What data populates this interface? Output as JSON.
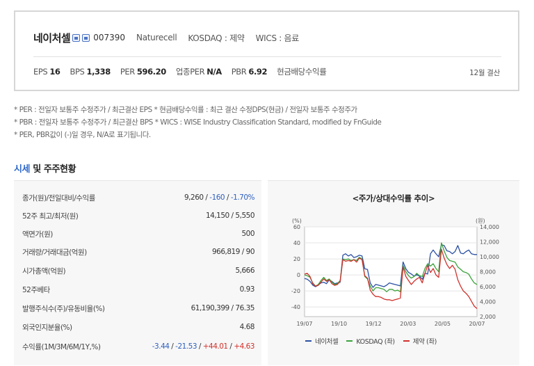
{
  "company": {
    "name": "네이처셀",
    "code": "007390",
    "english_name": "Naturecell",
    "market": "KOSDAQ : 제약",
    "wics": "WICS : 음료",
    "settlement": "12월 결산",
    "metrics": [
      {
        "label": "EPS",
        "value": "16"
      },
      {
        "label": "BPS",
        "value": "1,338"
      },
      {
        "label": "PER",
        "value": "596.20"
      },
      {
        "label": "업종PER",
        "value": "N/A"
      },
      {
        "label": "PBR",
        "value": "6.92"
      },
      {
        "label": "현금배당수익률",
        "value": ""
      }
    ]
  },
  "notes": [
    "* PER : 전일자 보통주 수정주가 / 최근결산 EPS * 현금배당수익률 : 최근 결산 수정DPS(현금) / 전일자 보통주 수정주가",
    "* PBR : 전일자 보통주 수정주가 / 최근결산 BPS * WICS : WISE Industry Classification Standard, modified by FnGuide",
    "* PER, PBR값이 (-)일 경우, N/A로 표기됩니다."
  ],
  "section": {
    "title_accent": "시세",
    "title_rest": " 및 주주현황"
  },
  "stats": {
    "price_label": "종가(원)/전일대비/수익률",
    "price": "9,260",
    "change": "-160",
    "change_rate": "-1.70%",
    "rows": [
      {
        "label": "52주 최고/최저(원)",
        "value": "14,150 / 5,550"
      },
      {
        "label": "액면가(원)",
        "value": "500"
      },
      {
        "label": "거래량/거래대금(억원)",
        "value": "966,819 / 90"
      },
      {
        "label": "시가총액(억원)",
        "value": "5,666"
      },
      {
        "label": "52주베타",
        "value": "0.93"
      },
      {
        "label": "발행주식수(주)/유동비율(%)",
        "value": "61,190,399 / 76.35"
      },
      {
        "label": "외국인지분율(%)",
        "value": "4.68"
      }
    ],
    "returns_label": "수익률(1M/3M/6M/1Y,%)",
    "returns": [
      "-3.44",
      "-21.53",
      "+44.01",
      "+4.63"
    ]
  },
  "chart_data": {
    "type": "line",
    "title": "<주가/상대수익률 추이>",
    "x_ticks": [
      "19/07",
      "19/10",
      "19/12",
      "20/03",
      "20/05",
      "20/07"
    ],
    "left_axis": {
      "unit": "(%)",
      "ticks": [
        60,
        40,
        20,
        0,
        -20,
        -40
      ],
      "range": [
        -52,
        60
      ]
    },
    "right_axis": {
      "unit": "(원)",
      "ticks": [
        "14,000",
        "12,000",
        "10,000",
        "8,000",
        "6,000",
        "4,000",
        "2,000"
      ],
      "range": [
        2000,
        14000
      ]
    },
    "series": [
      {
        "name": "네이처셀",
        "axis": "right",
        "color": "#2b4fa3",
        "values": [
          7100,
          7000,
          6700,
          6200,
          6000,
          6200,
          6500,
          6600,
          6400,
          6900,
          6700,
          6400,
          6500,
          6600,
          10200,
          10400,
          10100,
          10300,
          9900,
          10000,
          10200,
          10100,
          8400,
          8300,
          6500,
          5900,
          6300,
          6200,
          6100,
          6000,
          6200,
          6500,
          6400,
          6300,
          6200,
          6100,
          9300,
          8400,
          7900,
          7700,
          7400,
          7600,
          7400,
          7000,
          7800,
          7700,
          10400,
          10900,
          10400,
          10000,
          11600,
          11500,
          10800,
          10700,
          10400,
          10700,
          11500,
          10500,
          10400,
          10700,
          10900,
          10400,
          10300,
          10300
        ]
      },
      {
        "name": "KOSDAQ (좌)",
        "axis": "left",
        "color": "#3aa23a",
        "values": [
          0,
          -1,
          -3,
          -10,
          -14,
          -12,
          -7,
          -3,
          -7,
          -5,
          -9,
          -12,
          -11,
          -7,
          20,
          19,
          20,
          18,
          19,
          18,
          22,
          20,
          -2,
          -5,
          -14,
          -20,
          -16,
          -16,
          -17,
          -18,
          -21,
          -18,
          -18,
          -20,
          -19,
          -21,
          12,
          4,
          -1,
          -4,
          -2,
          2,
          -1,
          -2,
          8,
          14,
          11,
          14,
          8,
          4,
          40,
          30,
          22,
          18,
          17,
          16,
          10,
          7,
          4,
          3,
          1,
          -5,
          -10,
          -12
        ]
      },
      {
        "name": "제약 (좌)",
        "axis": "left",
        "color": "#d0312b",
        "values": [
          1,
          2,
          -2,
          -11,
          -14,
          -13,
          -9,
          -5,
          -8,
          -6,
          -11,
          -13,
          -12,
          -8,
          19,
          17,
          18,
          17,
          19,
          16,
          21,
          19,
          -1,
          -4,
          -19,
          -24,
          -27,
          -27,
          -28,
          -30,
          -31,
          -31,
          -32,
          -31,
          -30,
          -29,
          10,
          -2,
          -7,
          -12,
          -8,
          -5,
          -3,
          -10,
          2,
          12,
          3,
          8,
          0,
          -3,
          32,
          21,
          13,
          8,
          12,
          7,
          -6,
          -14,
          -20,
          -23,
          -27,
          -33,
          -39,
          -42
        ]
      }
    ]
  }
}
